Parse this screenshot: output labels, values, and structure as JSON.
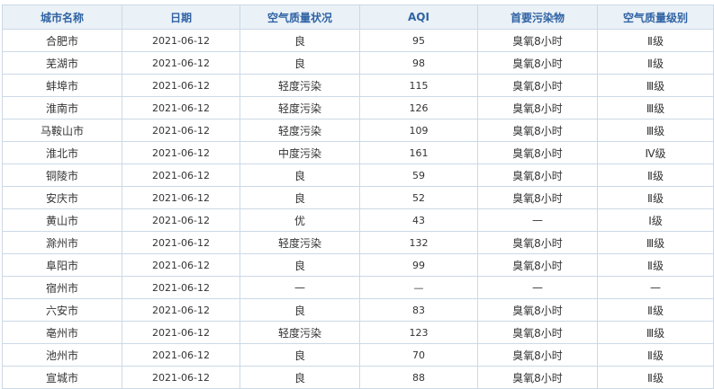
{
  "table": {
    "headers": [
      "城市名称",
      "日期",
      "空气质量状况",
      "AQI",
      "首要污染物",
      "空气质量级别"
    ],
    "rows": [
      [
        "合肥市",
        "2021-06-12",
        "良",
        "95",
        "臭氧8小时",
        "Ⅱ级"
      ],
      [
        "芜湖市",
        "2021-06-12",
        "良",
        "98",
        "臭氧8小时",
        "Ⅱ级"
      ],
      [
        "蚌埠市",
        "2021-06-12",
        "轻度污染",
        "115",
        "臭氧8小时",
        "Ⅲ级"
      ],
      [
        "淮南市",
        "2021-06-12",
        "轻度污染",
        "126",
        "臭氧8小时",
        "Ⅲ级"
      ],
      [
        "马鞍山市",
        "2021-06-12",
        "轻度污染",
        "109",
        "臭氧8小时",
        "Ⅲ级"
      ],
      [
        "淮北市",
        "2021-06-12",
        "中度污染",
        "161",
        "臭氧8小时",
        "Ⅳ级"
      ],
      [
        "铜陵市",
        "2021-06-12",
        "良",
        "59",
        "臭氧8小时",
        "Ⅱ级"
      ],
      [
        "安庆市",
        "2021-06-12",
        "良",
        "52",
        "臭氧8小时",
        "Ⅱ级"
      ],
      [
        "黄山市",
        "2021-06-12",
        "优",
        "43",
        "—",
        "Ⅰ级"
      ],
      [
        "滁州市",
        "2021-06-12",
        "轻度污染",
        "132",
        "臭氧8小时",
        "Ⅲ级"
      ],
      [
        "阜阳市",
        "2021-06-12",
        "良",
        "99",
        "臭氧8小时",
        "Ⅱ级"
      ],
      [
        "宿州市",
        "2021-06-12",
        "—",
        "—",
        "—",
        "—"
      ],
      [
        "六安市",
        "2021-06-12",
        "良",
        "83",
        "臭氧8小时",
        "Ⅱ级"
      ],
      [
        "亳州市",
        "2021-06-12",
        "轻度污染",
        "123",
        "臭氧8小时",
        "Ⅲ级"
      ],
      [
        "池州市",
        "2021-06-12",
        "良",
        "70",
        "臭氧8小时",
        "Ⅱ级"
      ],
      [
        "宣城市",
        "2021-06-12",
        "良",
        "88",
        "臭氧8小时",
        "Ⅱ级"
      ]
    ]
  }
}
